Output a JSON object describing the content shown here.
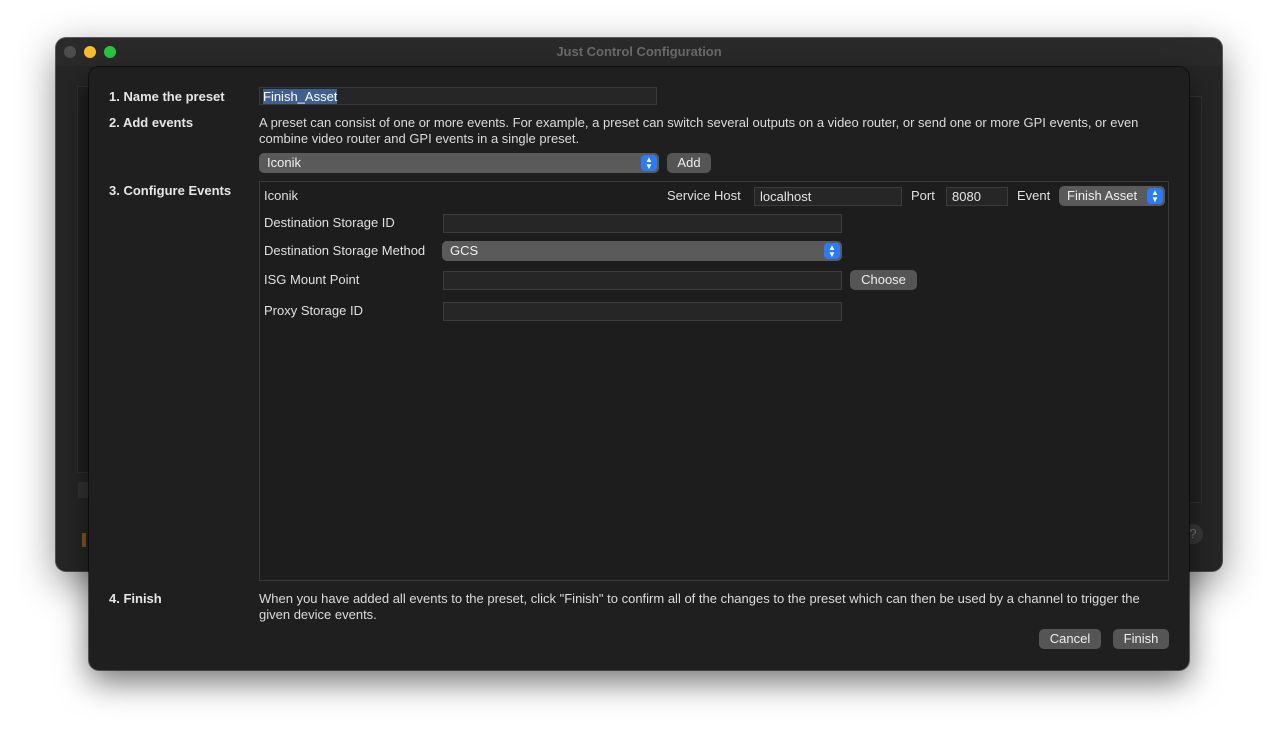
{
  "window": {
    "title": "Just Control Configuration",
    "help_glyph": "?"
  },
  "steps": {
    "name": "1. Name the preset",
    "add": "2. Add events",
    "configure": "3. Configure Events",
    "finish": "4. Finish"
  },
  "preset_name": "Finish_Asset",
  "add_description": "A preset can consist of one or more events. For example, a preset can switch several outputs on a video router, or send one or more GPI events, or even combine video router and GPI events in a single preset.",
  "event_type": {
    "selected": "Iconik"
  },
  "add_button": "Add",
  "event_config": {
    "title": "Iconik",
    "service_host_label": "Service Host",
    "service_host": "localhost",
    "port_label": "Port",
    "port": "8080",
    "event_label": "Event",
    "event_selected": "Finish Asset",
    "destination_storage_id_label": "Destination Storage ID",
    "destination_storage_id": "",
    "destination_storage_method_label": "Destination Storage Method",
    "destination_storage_method": "GCS",
    "isg_mount_point_label": "ISG Mount Point",
    "isg_mount_point": "",
    "choose_button": "Choose",
    "proxy_storage_id_label": "Proxy Storage ID",
    "proxy_storage_id": ""
  },
  "finish_description": "When you have added all events to the preset, click \"Finish\" to confirm all of the changes to the preset which can then be used by a channel to trigger the given device events.",
  "buttons": {
    "cancel": "Cancel",
    "finish": "Finish"
  },
  "colors": {
    "accent": "#2c7bf6",
    "selection": "#3e5f8f",
    "window_bg": "#1f1f1f"
  },
  "icons": {
    "popup_arrows": "chevron-up-down-icon"
  }
}
